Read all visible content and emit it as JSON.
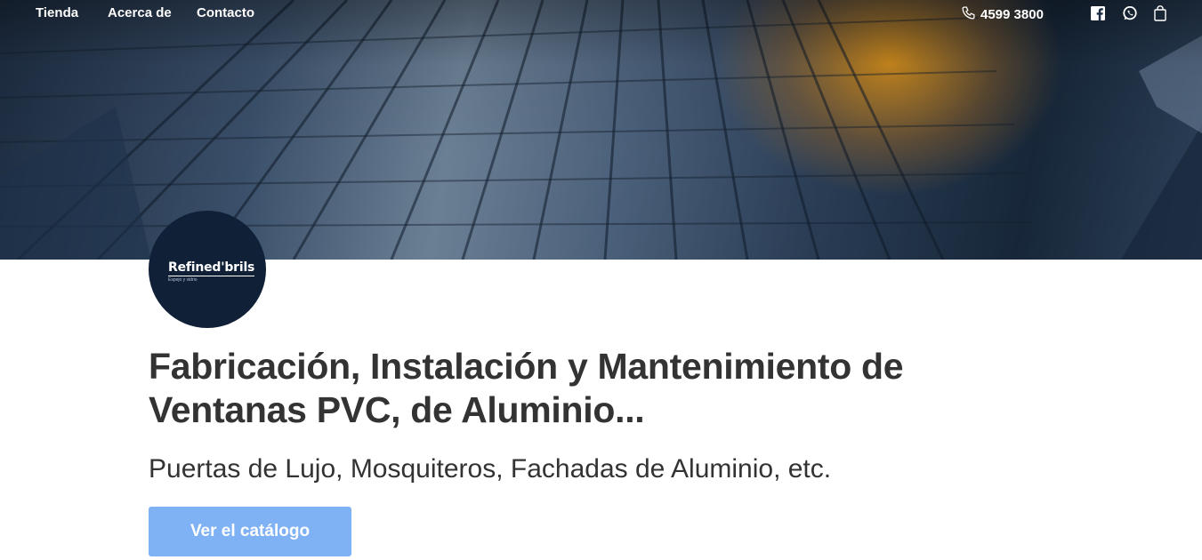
{
  "nav": {
    "links": [
      "Tienda",
      "Acerca de",
      "Contacto"
    ],
    "phone": "4599 3800",
    "icons": [
      "phone-icon",
      "facebook-icon",
      "whatsapp-icon",
      "cart-icon"
    ]
  },
  "logo": {
    "name": "Refined'brils",
    "tagline": "Espejo y vidrio"
  },
  "hero": {
    "title": "Fabricación, Instalación y Mantenimiento de Ventanas PVC, de Aluminio...",
    "subtitle": "Puertas de Lujo, Mosquiteros, Fachadas de Aluminio, etc.",
    "cta_label": "Ver el catálogo"
  },
  "colors": {
    "accent": "#7fb1f5",
    "logo_bg": "#0f2037",
    "text": "#333333",
    "glow": "#e6961a"
  }
}
